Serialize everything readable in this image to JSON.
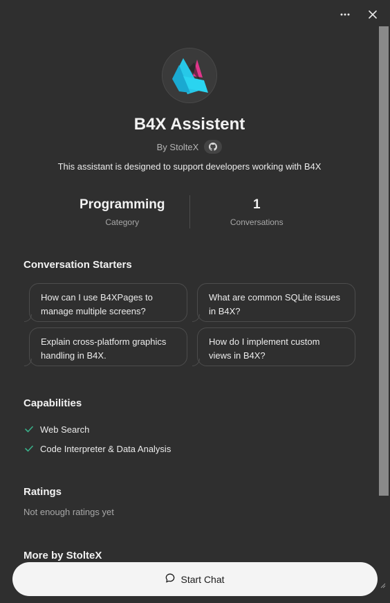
{
  "header": {
    "more_icon": "ellipsis-icon",
    "close_icon": "close-icon"
  },
  "gpt": {
    "name": "B4X Assistent",
    "author": "By StolteX",
    "description": "This assistant is designed to support developers working with B4X"
  },
  "stats": [
    {
      "value": "Programming",
      "label": "Category"
    },
    {
      "value": "1",
      "label": "Conversations"
    }
  ],
  "sections": {
    "starters_title": "Conversation Starters",
    "capabilities_title": "Capabilities",
    "ratings_title": "Ratings",
    "more_title": "More by StolteX"
  },
  "starters": [
    "How can I use B4XPages to manage multiple screens?",
    "What are common SQLite issues in B4X?",
    "Explain cross-platform graphics handling in B4X.",
    "How do I implement custom views in B4X?"
  ],
  "capabilities": [
    "Web Search",
    "Code Interpreter & Data Analysis"
  ],
  "ratings_text": "Not enough ratings yet",
  "start_button": "Start Chat",
  "colors": {
    "background": "#2f2f2f",
    "check": "#3ab08a",
    "logo_cyan": "#27c8e8",
    "logo_pink": "#e0358a"
  }
}
